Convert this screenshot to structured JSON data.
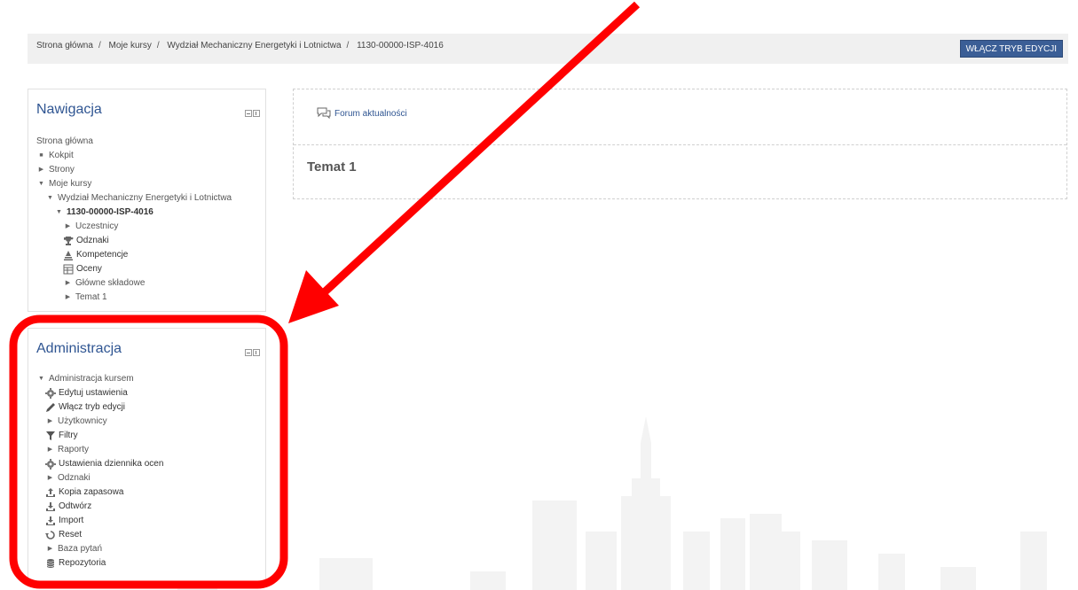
{
  "breadcrumb": [
    "Strona główna",
    "Moje kursy",
    "Wydział Mechaniczny Energetyki i Lotnictwa",
    "1130-00000-ISP-4016"
  ],
  "header": {
    "edit_button": "WŁĄCZ TRYB EDYCJI"
  },
  "nav_block": {
    "title": "Nawigacja",
    "items": {
      "home": "Strona główna",
      "dashboard": "Kokpit",
      "pages": "Strony",
      "mycourses": "Moje kursy",
      "faculty": "Wydział Mechaniczny Energetyki i Lotnictwa",
      "course": "1130-00000-ISP-4016",
      "participants": "Uczestnicy",
      "badges": "Odznaki",
      "competencies": "Kompetencje",
      "grades": "Oceny",
      "general": "Główne składowe",
      "topic1": "Temat 1"
    }
  },
  "admin_block": {
    "title": "Administracja",
    "items": {
      "course_admin": "Administracja kursem",
      "edit_settings": "Edytuj ustawienia",
      "edit_mode": "Włącz tryb edycji",
      "users": "Użytkownicy",
      "filters": "Filtry",
      "reports": "Raporty",
      "gradebook_setup": "Ustawienia dziennika ocen",
      "badges": "Odznaki",
      "backup": "Kopia zapasowa",
      "restore": "Odtwórz",
      "import": "Import",
      "reset": "Reset",
      "question_bank": "Baza pytań",
      "repositories": "Repozytoria"
    }
  },
  "main": {
    "forum_link": "Forum aktualności",
    "topic_title": "Temat 1"
  },
  "colors": {
    "link": "#2f5592",
    "button": "#3b5e96",
    "annotation": "#ff0000",
    "skyline": "#f2f2f2"
  }
}
